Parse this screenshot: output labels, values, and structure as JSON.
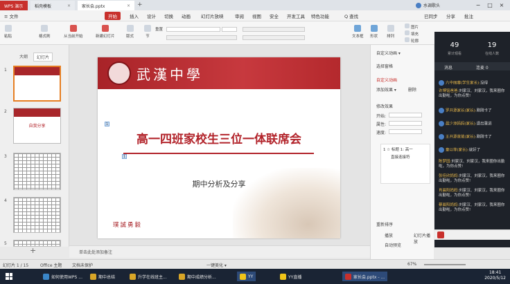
{
  "titlebar": {
    "tabs": [
      {
        "label": "WPS 演示"
      },
      {
        "label": "稻壳模板"
      },
      {
        "label": "家长会.pptx"
      }
    ],
    "right": {
      "user": "水调歌头",
      "min": "−",
      "max": "□",
      "close": "×"
    }
  },
  "menubar": {
    "file": "≡ 文件",
    "items": [
      "开始",
      "插入",
      "设计",
      "切换",
      "动画",
      "幻灯片放映",
      "审阅",
      "视图",
      "安全",
      "开发工具",
      "特色功能"
    ],
    "search": "Q 查找",
    "right": [
      "已同步",
      "分享",
      "批注"
    ]
  },
  "toolbar": {
    "paste": "粘贴",
    "format_painter": "格式刷",
    "play": "从当前开始",
    "new_slide": "新建幻灯片",
    "layout": "版式",
    "section": "节",
    "reset": "重置",
    "textbox": "文本框",
    "shape": "形状",
    "arrange": "排列",
    "picture": "图片",
    "fill": "填充",
    "outline": "轮廓"
  },
  "thumbs": {
    "tabs": [
      "大纲",
      "幻灯片"
    ],
    "numbers": [
      "1",
      "2",
      "3",
      "4",
      "5"
    ],
    "slide2_text": "自我分享"
  },
  "slide": {
    "school": "武漢中學",
    "title": "高一四班家校生三位一体联席会",
    "subtitle": "期中分析及分享",
    "motto": "璞誠勇毅",
    "markers": [
      "1",
      "1"
    ]
  },
  "notes": {
    "placeholder": "单击此处添加备注"
  },
  "anim": {
    "title": "自定义动画 ▾",
    "select_pane": "选择窗格",
    "custom": "自定义动画",
    "add": "添加效果 ▾",
    "remove": "删除",
    "modify": "修改效果",
    "start": "开始:",
    "property": "属性:",
    "speed": "速度:",
    "items": [
      "1 ☆ 标题 1: 高一",
      "直接连接符"
    ],
    "reorder": "重新排序",
    "play": "播放",
    "slideshow": "幻灯片播放",
    "autopreview": "自动预览"
  },
  "live": {
    "stats": [
      {
        "value": "49",
        "label": "累计观看"
      },
      {
        "value": "19",
        "label": "在线人数"
      }
    ],
    "tabs": [
      "消息",
      "连麦 0"
    ],
    "chat": [
      {
        "name": "六中丽蓉(学生家长):",
        "msg": "没得"
      },
      {
        "name": "许博铭爸爸:",
        "msg": "刘家汉、刘家汉，我来圈你出勤啦，为你点赞!"
      },
      {
        "name": "罗开源家长(家长):",
        "msg": "刚刚卡了"
      },
      {
        "name": "晨少添妈妈(家长):",
        "msg": "退出重进"
      },
      {
        "name": "王开源爸爸(家长):",
        "msg": "刚刚卡了"
      },
      {
        "name": "童以菲(家长):",
        "msg": "就好了"
      },
      {
        "name": "陈梦园:",
        "msg": "刘家汉、刘家汉，我来圈你出勤啦，为你点赞!"
      },
      {
        "name": "张佳欣妈妈:",
        "msg": "刘家汉、刘家汉，我来圈你出勤啦，为你点赞!"
      },
      {
        "name": "肖晨阳妈妈:",
        "msg": "刘家汉、刘家汉，我来圈你出勤啦，为你点赞!"
      },
      {
        "name": "蔡晨阳妈妈:",
        "msg": "刘家汉、刘家汉，我来圈你出勤啦，为你点赞!"
      }
    ]
  },
  "status": {
    "page": "幻灯片 1 / 15",
    "theme": "Office 主题",
    "protect": "文档未保护",
    "beautify": "一键美化 ▾",
    "zoom": "67%"
  },
  "taskbar": {
    "items": [
      "如何使用WPS ...",
      "期中总结",
      "升学在线班主...",
      "期中成绩分析...",
      "YY",
      "YY直播",
      "家长会.pptx - ..."
    ],
    "time": "18:41",
    "date": "2020/5/12"
  },
  "colors": {
    "brand": "#c8302c",
    "live_bg": "#1e2229",
    "slide_red": "#b2232a"
  }
}
